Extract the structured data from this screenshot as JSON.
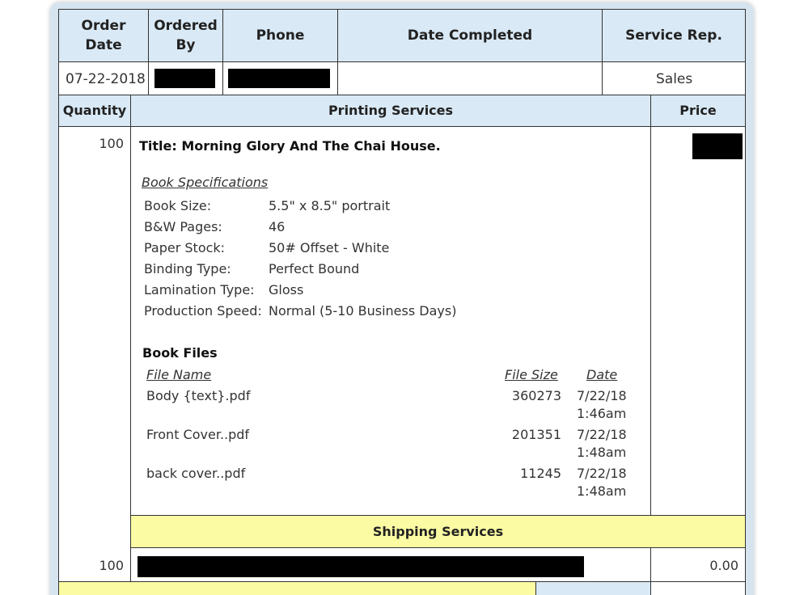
{
  "order_header": {
    "order_date": "Order Date",
    "ordered_by": "Ordered By",
    "phone": "Phone",
    "date_completed": "Date Completed",
    "service_rep": "Service Rep."
  },
  "order_values": {
    "order_date": "07-22-2018",
    "date_completed": "",
    "service_rep": "Sales"
  },
  "items_header": {
    "quantity": "Quantity",
    "printing_services": "Printing Services",
    "price": "Price"
  },
  "printing_item": {
    "quantity": "100",
    "title": "Title: Morning Glory And The Chai House.",
    "specs_heading": "Book Specifications",
    "specs": [
      {
        "label": "Book Size:",
        "value": "5.5\" x 8.5\" portrait"
      },
      {
        "label": "B&W Pages:",
        "value": "46"
      },
      {
        "label": "Paper Stock:",
        "value": "50# Offset - White"
      },
      {
        "label": "Binding Type:",
        "value": "Perfect Bound"
      },
      {
        "label": "Lamination Type:",
        "value": "Gloss"
      },
      {
        "label": "Production Speed:",
        "value": "Normal (5-10 Business Days)"
      }
    ],
    "files_heading": "Book Files",
    "files_columns": {
      "name": "File Name",
      "size": "File Size",
      "date": "Date"
    },
    "files": [
      {
        "name": "Body {text}.pdf",
        "size": "360273",
        "date": "7/22/18",
        "time": "1:46am"
      },
      {
        "name": "Front Cover..pdf",
        "size": "201351",
        "date": "7/22/18",
        "time": "1:48am"
      },
      {
        "name": "back cover..pdf",
        "size": "11245",
        "date": "7/22/18",
        "time": "1:48am"
      }
    ]
  },
  "shipping": {
    "heading": "Shipping Services",
    "quantity": "100",
    "price": "0.00"
  }
}
